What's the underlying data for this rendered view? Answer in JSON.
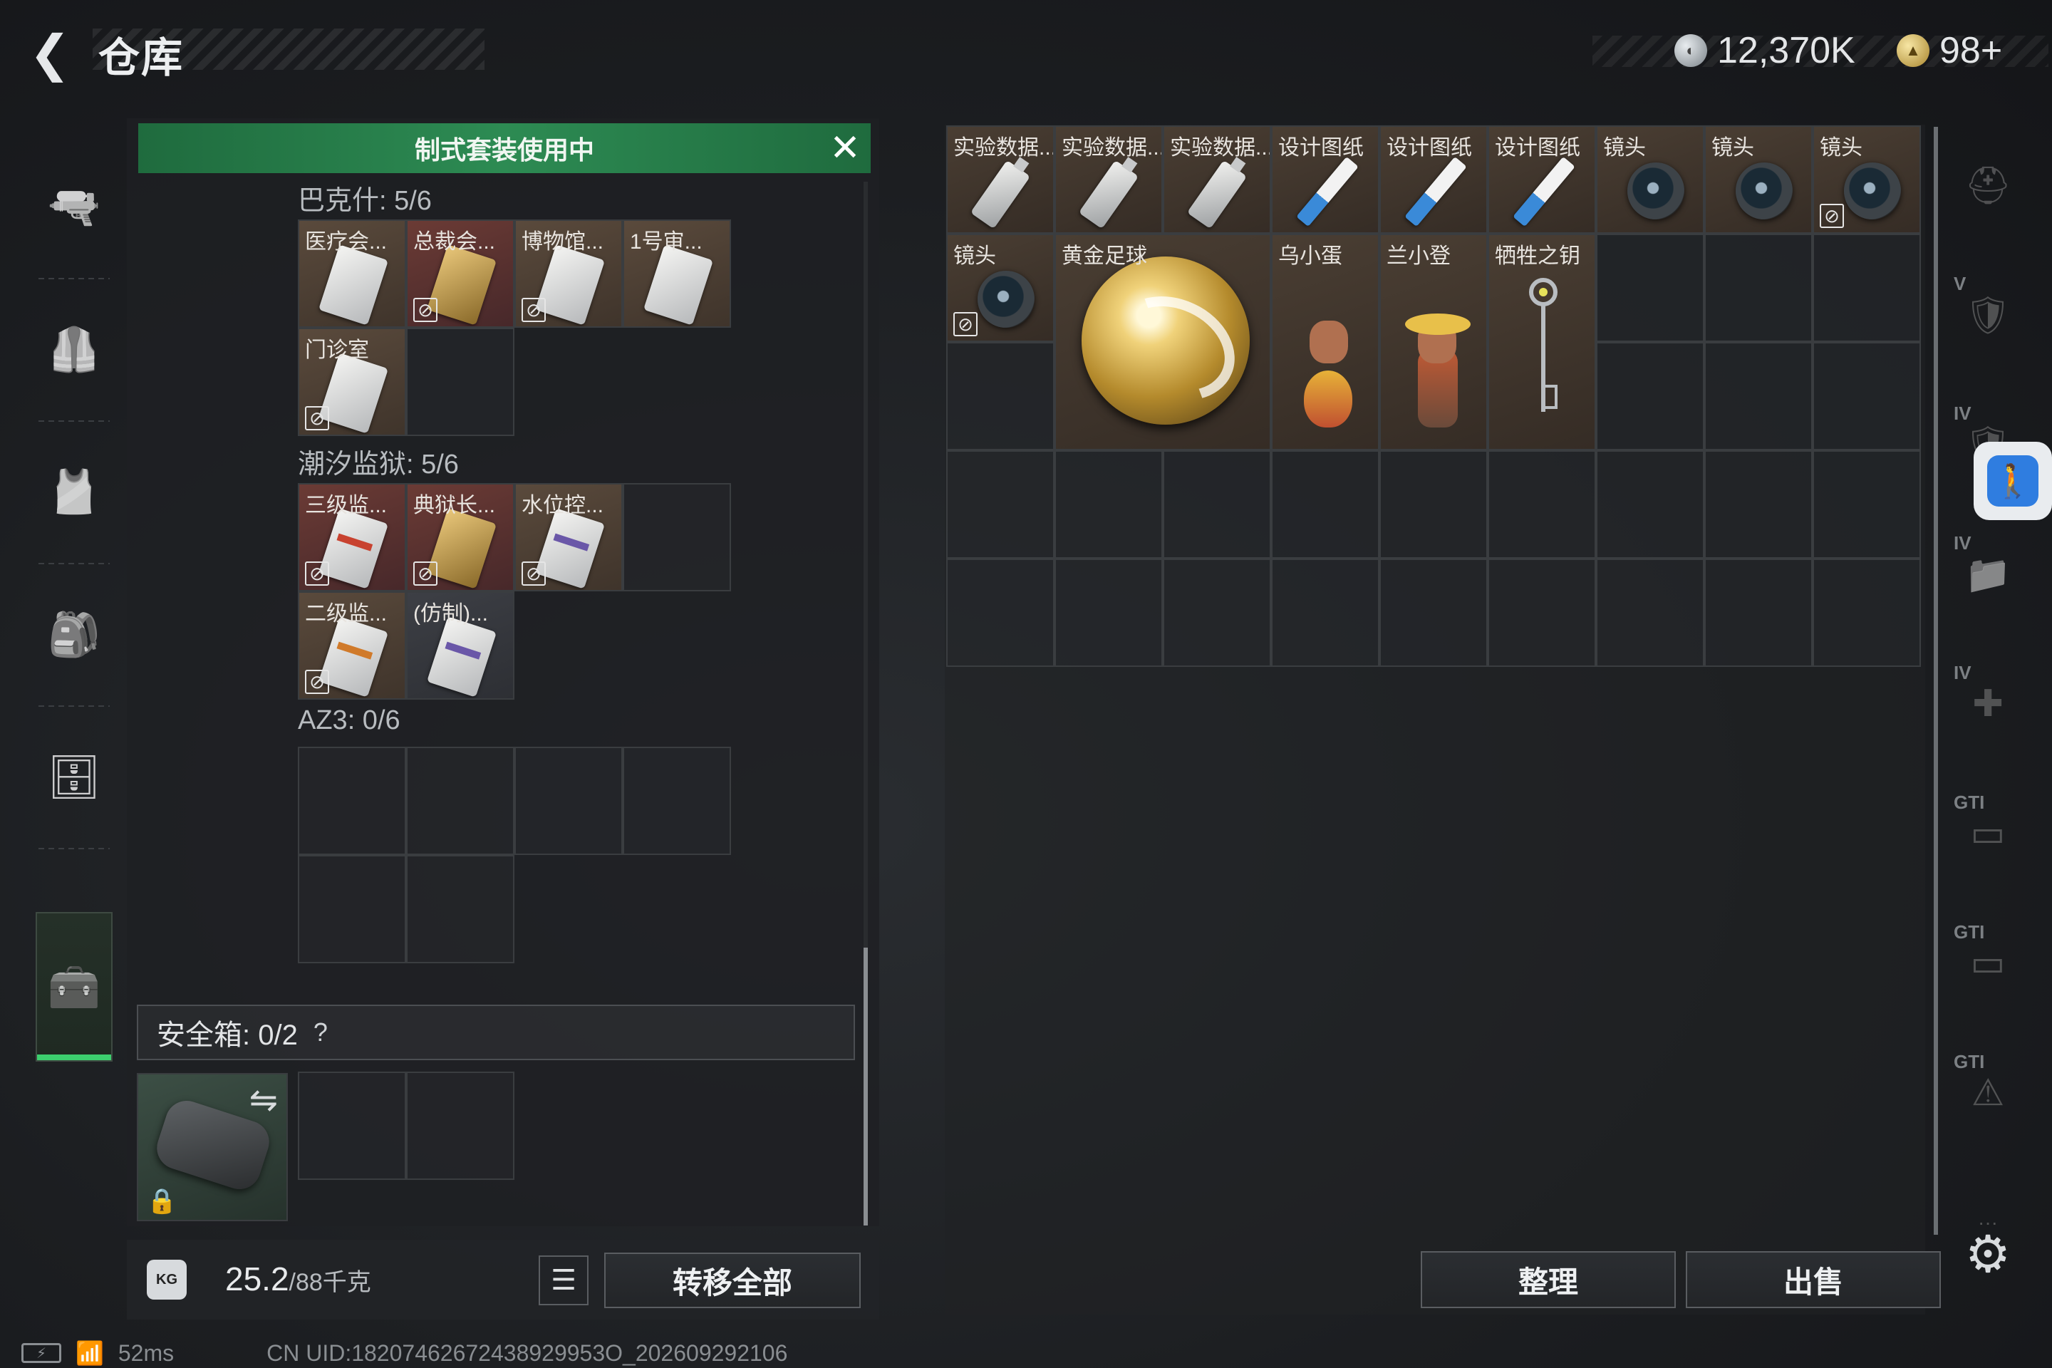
{
  "header": {
    "back_glyph": "❮",
    "title": "仓库"
  },
  "currency": {
    "silver": "12,370K",
    "gold": "98+"
  },
  "left_nav": {
    "items": [
      {
        "icon": "gun-icon",
        "glyph": "🔫"
      },
      {
        "icon": "armor-vest-icon",
        "glyph": "🦺"
      },
      {
        "icon": "chest-rig-icon",
        "glyph": "🎽"
      },
      {
        "icon": "backpack-icon",
        "glyph": "🎒"
      },
      {
        "icon": "container-icon",
        "glyph": "🗄"
      },
      {
        "icon": "toolbox-icon",
        "glyph": "🧰",
        "active": true
      }
    ]
  },
  "suit_banner": {
    "text": "制式套装使用中",
    "close_glyph": "✕"
  },
  "sections": [
    {
      "title": "巴克什: 5/6",
      "cells": [
        {
          "label": "医疗会...",
          "style": "filled",
          "card": "",
          "stripe": "",
          "locked": false
        },
        {
          "label": "总裁会...",
          "style": "red",
          "card": "gold",
          "stripe": "",
          "locked": true
        },
        {
          "label": "博物馆...",
          "style": "filled",
          "card": "",
          "stripe": "",
          "locked": true
        },
        {
          "label": "1号审...",
          "style": "filled",
          "card": "",
          "stripe": "",
          "locked": false
        },
        {
          "label": "门诊室",
          "style": "filled",
          "card": "",
          "stripe": "",
          "locked": true
        },
        {
          "label": "",
          "style": "empty"
        }
      ]
    },
    {
      "title": "潮汐监狱: 5/6",
      "cells": [
        {
          "label": "三级监...",
          "style": "red",
          "card": "",
          "stripe": "red",
          "locked": true
        },
        {
          "label": "典狱长...",
          "style": "red",
          "card": "gold",
          "stripe": "",
          "locked": true
        },
        {
          "label": "水位控...",
          "style": "filled",
          "card": "",
          "stripe": "purple",
          "locked": true
        },
        {
          "label": "",
          "style": "empty"
        },
        {
          "label": "二级监...",
          "style": "filled",
          "card": "",
          "stripe": "orange",
          "locked": true
        },
        {
          "label": "(仿制)...",
          "style": "dark",
          "card": "",
          "stripe": "purple",
          "locked": false
        }
      ]
    },
    {
      "title": "AZ3: 0/6",
      "cells": [
        {
          "label": "",
          "style": "empty"
        },
        {
          "label": "",
          "style": "empty"
        },
        {
          "label": "",
          "style": "empty"
        },
        {
          "label": "",
          "style": "empty"
        },
        {
          "label": "",
          "style": "empty"
        },
        {
          "label": "",
          "style": "empty"
        }
      ]
    }
  ],
  "safe_box": {
    "label": "安全箱: 0/2",
    "help": "?",
    "swap_glyph": "⇋",
    "lock_glyph": "🔒"
  },
  "weight": {
    "current": "25.2",
    "max": "/88千克",
    "badge": "KG"
  },
  "list_glyph": "☰",
  "transfer_all": "转移全部",
  "status": {
    "battery": "⚡",
    "wifi": "📶",
    "ping": "52ms",
    "uid": "CN UID:18207462672438929953O_202609292106"
  },
  "right_items": {
    "row1": [
      {
        "label": "实验数据...",
        "kind": "usb",
        "locked": false
      },
      {
        "label": "实验数据...",
        "kind": "usb",
        "locked": false
      },
      {
        "label": "实验数据...",
        "kind": "usb",
        "locked": false
      },
      {
        "label": "设计图纸",
        "kind": "blueprint",
        "locked": false
      },
      {
        "label": "设计图纸",
        "kind": "blueprint",
        "locked": false
      },
      {
        "label": "设计图纸",
        "kind": "blueprint",
        "locked": false
      },
      {
        "label": "镜头",
        "kind": "lens",
        "locked": false
      },
      {
        "label": "镜头",
        "kind": "lens",
        "locked": false
      },
      {
        "label": "镜头",
        "kind": "lens",
        "locked": true
      }
    ],
    "lens2": {
      "label": "镜头"
    },
    "golden_ball": {
      "label": "黄金足球"
    },
    "wu_xiaodan": {
      "label": "乌小蛋"
    },
    "lan_xiaodeng": {
      "label": "兰小登"
    },
    "sacrifice_key": {
      "label": "牺牲之钥"
    }
  },
  "right_nav": [
    {
      "icon": "helmet-icon",
      "tag": "",
      "glyph": "⛑"
    },
    {
      "icon": "armor-tier5-icon",
      "tag": "V",
      "glyph": "🛡"
    },
    {
      "icon": "armor-tier4-icon",
      "tag": "IV",
      "glyph": "🛡"
    },
    {
      "icon": "folder-tier4-icon",
      "tag": "IV",
      "glyph": "📁"
    },
    {
      "icon": "medkit-tier4-icon",
      "tag": "IV",
      "glyph": "✚"
    },
    {
      "icon": "gti-rifle-icon",
      "tag": "GTI",
      "glyph": "▭"
    },
    {
      "icon": "gti-vehicle-icon",
      "tag": "GTI",
      "glyph": "▭"
    },
    {
      "icon": "gti-alert-icon",
      "tag": "GTI",
      "glyph": "⚠"
    },
    {
      "icon": "more-icon",
      "tag": "",
      "glyph": "···"
    }
  ],
  "accessibility_glyph": "🚶",
  "gear_glyph": "⚙",
  "sort_button": "整理",
  "sell_button": "出售"
}
